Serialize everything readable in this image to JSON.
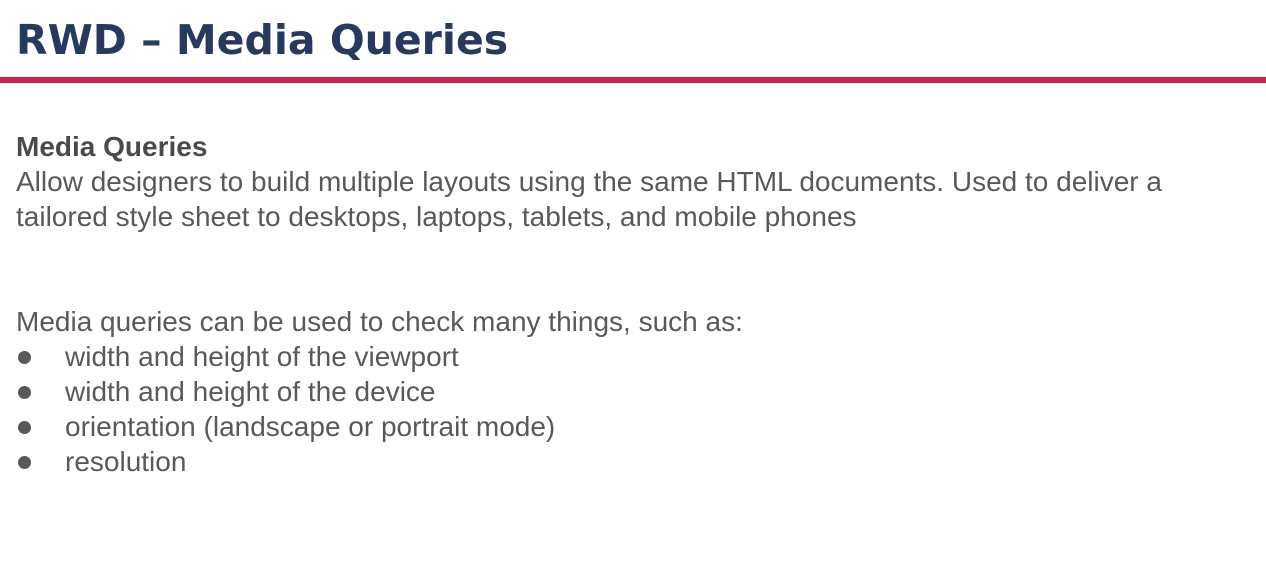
{
  "slide": {
    "title": "RWD – Media Queries",
    "section_heading": "Media Queries",
    "intro": "Allow designers to build multiple layouts using the same HTML documents.  Used to deliver a tailored style sheet to desktops, laptops, tablets, and mobile phones",
    "list_lead": "Media queries can be used to check many things, such as:",
    "bullets": [
      "width and height of the viewport",
      "width and height of the device",
      "orientation (landscape or portrait mode)",
      "resolution"
    ]
  },
  "colors": {
    "title": "#253a5e",
    "accent_rule": "#d81e45",
    "body_text": "#595959"
  }
}
